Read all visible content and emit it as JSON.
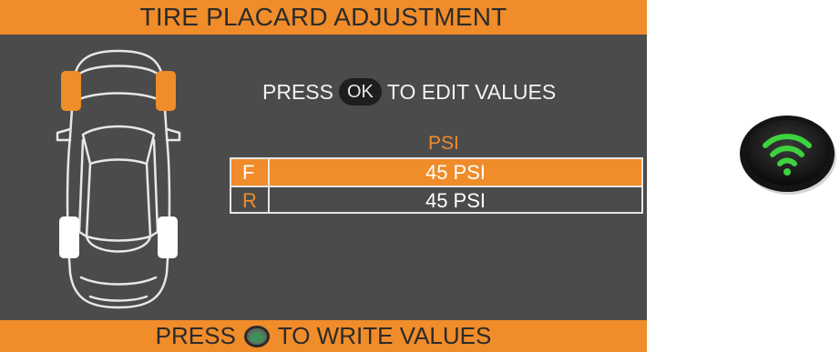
{
  "screen": {
    "title": "TIRE PLACARD ADJUSTMENT",
    "instruction": {
      "prefix": "PRESS",
      "button_label": "OK",
      "suffix": "TO EDIT VALUES"
    },
    "table": {
      "unit_header": "PSI",
      "rows": [
        {
          "label": "F",
          "value": "45 PSI",
          "selected": true
        },
        {
          "label": "R",
          "value": "45 PSI",
          "selected": false
        }
      ]
    },
    "footer": {
      "prefix": "PRESS",
      "suffix": "TO WRITE VALUES",
      "icon": "green-button-icon"
    }
  },
  "car_diagram": {
    "highlighted_tires": [
      "front-left",
      "front-right"
    ],
    "normal_tires": [
      "rear-left",
      "rear-right"
    ]
  },
  "write_button": {
    "icon": "wifi-signal-icon"
  },
  "colors": {
    "accent": "#f08c2a",
    "screen_background": "#4b4b4b",
    "signal_green": "#3fd23f"
  }
}
